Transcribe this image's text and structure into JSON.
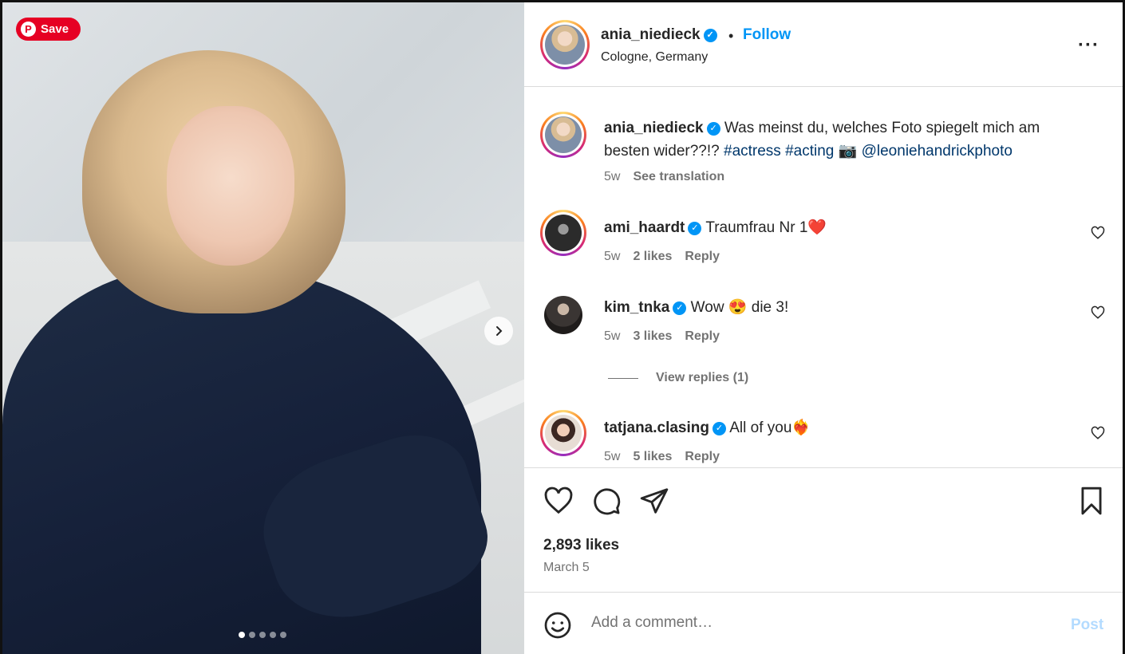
{
  "photo": {
    "save_label": "Save",
    "pin_glyph": "P",
    "carousel_count": 5,
    "carousel_active_index": 0
  },
  "post": {
    "author": "ania_niedieck",
    "follow_label": "Follow",
    "location": "Cologne, Germany",
    "separator": "•"
  },
  "caption": {
    "username": "ania_niedieck",
    "text_main": "Was meinst du, welches Foto spiegelt mich am besten wider??!?",
    "tag1": "#actress",
    "tag2": "#acting",
    "camera_emoji": "📷",
    "mention": "@leoniehandrickphoto",
    "time": "5w",
    "see_translation": "See translation"
  },
  "comments": [
    {
      "username": "ami_haardt",
      "text": "Traumfrau Nr 1❤️",
      "time": "5w",
      "likes": "2 likes",
      "reply": "Reply"
    },
    {
      "username": "kim_tnka",
      "text": "Wow 😍 die 3!",
      "time": "5w",
      "likes": "3 likes",
      "reply": "Reply"
    },
    {
      "username": "tatjana.clasing",
      "text": "All of you❤️‍🔥",
      "time": "5w",
      "likes": "5 likes",
      "reply": "Reply"
    }
  ],
  "view_replies": "View replies (1)",
  "stats": {
    "likes": "2,893 likes",
    "date": "March 5"
  },
  "add_comment": {
    "placeholder": "Add a comment…",
    "post_label": "Post"
  },
  "colors": {
    "pinterest_red": "#e60023",
    "instagram_blue": "#0095f6",
    "link": "#00376b",
    "muted": "#737373"
  }
}
